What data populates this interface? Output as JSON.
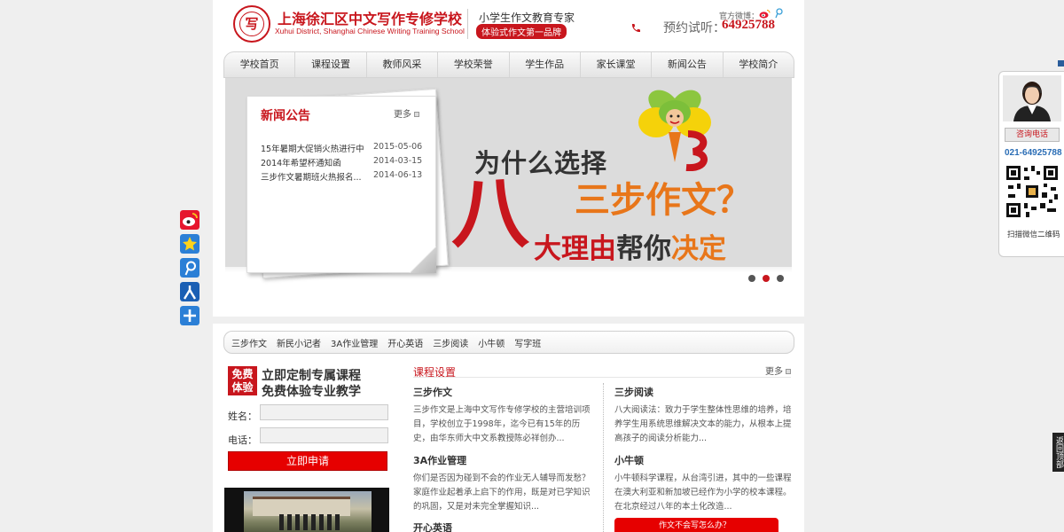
{
  "header": {
    "logo_char": "写作",
    "school_name": "上海徐汇区中文写作专修学校",
    "school_name_en": "Xuhui District, Shanghai Chinese Writing Training School",
    "slogan": "小学生作文教育专家",
    "slogan_badge": "体验式作文第一品牌",
    "weibo_label": "官方微博：",
    "phone_label": "预约试听：",
    "phone_number": "64925788"
  },
  "nav": {
    "items": [
      "学校首页",
      "课程设置",
      "教师风采",
      "学校荣誉",
      "学生作品",
      "家长课堂",
      "新闻公告",
      "学校简介"
    ]
  },
  "banner": {
    "question": "为什么选择",
    "brand": "三步作文？",
    "eight": "八",
    "reason_a": "大理由",
    "reason_b": "帮你",
    "reason_c": "决定"
  },
  "news": {
    "title": "新闻公告",
    "more": "更多",
    "items": [
      {
        "title": "15年暑期大促销火热进行中",
        "date": "2015-05-06"
      },
      {
        "title": "2014年希望杯通知函",
        "date": "2014-03-15"
      },
      {
        "title": "三步作文暑期班火热报名...",
        "date": "2014-06-13"
      }
    ]
  },
  "course_tabs": [
    "三步作文",
    "新民小记者",
    "3A作业管理",
    "开心英语",
    "三步阅读",
    "小牛顿",
    "写字班"
  ],
  "trial": {
    "badge_line1": "免费",
    "badge_line2": "体验",
    "title1": "立即定制专属课程",
    "title2": "免费体验专业教学",
    "name_label": "姓名：",
    "phone_label": "电话：",
    "name_value": "",
    "phone_value": "",
    "submit": "立即申请"
  },
  "courses": {
    "title": "课程设置",
    "more": "更多",
    "items": [
      {
        "name": "三步作文",
        "desc": "三步作文是上海中文写作专修学校的主营培训项目，学校创立于1998年，迄今已有15年的历史，由华东师大中文系教授陈必祥创办..."
      },
      {
        "name": "三步阅读",
        "desc": "八大阅读法：致力于学生整体性思维的培养，培养学生用系统思维解决文本的能力，从根本上提高孩子的阅读分析能力..."
      },
      {
        "name": "3A作业管理",
        "desc": "你们是否因为碰到不会的作业无人辅导而发愁？家庭作业起着承上启下的作用，既是对已学知识的巩固，又是对未完全掌握知识..."
      },
      {
        "name": "小牛顿",
        "desc": "小牛顿科学课程，从台湾引进，其中的一些课程在澳大利亚和新加坡已经作为小学的校本课程。在北京经过八年的本土化改造..."
      },
      {
        "name": "开心英语",
        "desc": ""
      }
    ],
    "help_button": "作文不会写怎么办？"
  },
  "consult": {
    "button": "咨询电话",
    "phone": "021-64925788",
    "qr_caption": "扫描微信二维码"
  },
  "back_to_top": "返回顶部",
  "colors": {
    "brand_red": "#c8161d",
    "orange": "#e8761a",
    "link_blue": "#2a6db5"
  }
}
